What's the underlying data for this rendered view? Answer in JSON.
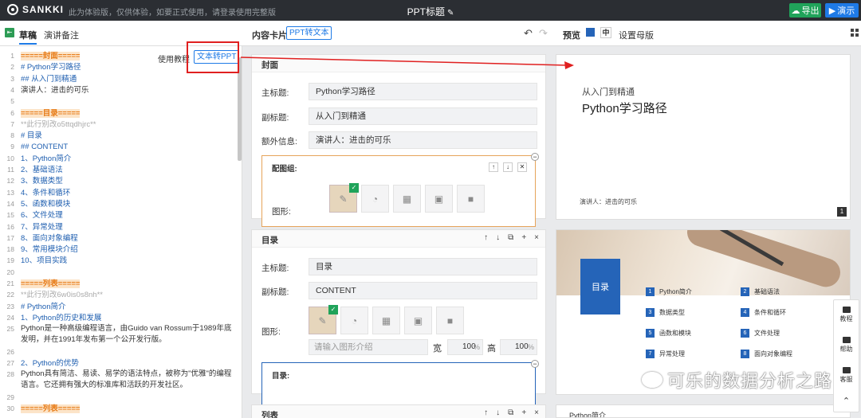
{
  "topbar": {
    "brand": "SANKKI",
    "trial_notice": "此为体验版，仅供体验，如要正式使用，请登录使用完整版",
    "doc_title": "PPT标题",
    "export_label": "导出",
    "present_label": "演示"
  },
  "toolbar": {
    "tab_draft": "草稿",
    "tab_notes": "演讲备注",
    "content_cards_title": "内容卡片",
    "ppt_to_text": "PPT转文本",
    "preview_label": "预览",
    "size_mid": "中",
    "set_master": "设置母版"
  },
  "editor": {
    "usage_link": "使用教程",
    "text_to_ppt": "文本转PPT",
    "lines": [
      {
        "n": "1",
        "text": "=====封面=====",
        "kind": "hl"
      },
      {
        "n": "2",
        "text": "# Python学习路径",
        "kind": "hd"
      },
      {
        "n": "3",
        "text": "## 从入门到精通",
        "kind": "hd"
      },
      {
        "n": "4",
        "text": "演讲人：进击的可乐",
        "kind": "plain"
      },
      {
        "n": "5",
        "text": "",
        "kind": "plain"
      },
      {
        "n": "6",
        "text": "=====目录=====",
        "kind": "hl"
      },
      {
        "n": "7",
        "text": "**此行别改o5ttqdhjrc**",
        "kind": "cm"
      },
      {
        "n": "8",
        "text": "# 目录",
        "kind": "hd"
      },
      {
        "n": "9",
        "text": "## CONTENT",
        "kind": "hd"
      },
      {
        "n": "10",
        "text": "1、Python简介",
        "kind": "ol"
      },
      {
        "n": "11",
        "text": "2、基础语法",
        "kind": "ol"
      },
      {
        "n": "12",
        "text": "3、数据类型",
        "kind": "ol"
      },
      {
        "n": "13",
        "text": "4、条件和循环",
        "kind": "ol"
      },
      {
        "n": "14",
        "text": "5、函数和模块",
        "kind": "ol"
      },
      {
        "n": "15",
        "text": "6、文件处理",
        "kind": "ol"
      },
      {
        "n": "16",
        "text": "7、异常处理",
        "kind": "ol"
      },
      {
        "n": "17",
        "text": "8、面向对象编程",
        "kind": "ol"
      },
      {
        "n": "18",
        "text": "9、常用模块介绍",
        "kind": "ol"
      },
      {
        "n": "19",
        "text": "10、项目实践",
        "kind": "ol"
      },
      {
        "n": "20",
        "text": "",
        "kind": "plain"
      },
      {
        "n": "21",
        "text": "=====列表=====",
        "kind": "hl"
      },
      {
        "n": "22",
        "text": "**此行别改6w0is0s8nh**",
        "kind": "cm"
      },
      {
        "n": "23",
        "text": "# Python简介",
        "kind": "hd"
      },
      {
        "n": "24",
        "text": "1、Python的历史和发展",
        "kind": "ol"
      },
      {
        "n": "25",
        "text": "Python是一种高级编程语言，由Guido van Rossum于1989年底发明，并在1991年发布第一个公开发行版。",
        "kind": "wrap"
      },
      {
        "n": "26",
        "text": "",
        "kind": "plain"
      },
      {
        "n": "27",
        "text": "2、Python的优势",
        "kind": "ol"
      },
      {
        "n": "28",
        "text": "Python具有简洁、易读、易学的语法特点，被称为\"优雅\"的编程语言。它还拥有强大的标准库和活跃的开发社区。",
        "kind": "wrap"
      },
      {
        "n": "29",
        "text": "",
        "kind": "plain"
      },
      {
        "n": "30",
        "text": "=====列表=====",
        "kind": "hl"
      }
    ]
  },
  "cards": {
    "cover": {
      "title": "封面",
      "main_title_label": "主标题:",
      "main_title_value": "Python学习路径",
      "subtitle_label": "副标题:",
      "subtitle_value": "从入门到精通",
      "extra_label": "额外信息:",
      "extra_value": "演讲人：进击的可乐",
      "group_label": "配图组:",
      "shape_label": "图形:"
    },
    "toc": {
      "title": "目录",
      "main_title_label": "主标题:",
      "main_title_value": "目录",
      "subtitle_label": "副标题:",
      "subtitle_value": "CONTENT",
      "shape_label": "图形:",
      "shape_placeholder": "请输入图形介绍",
      "width_label": "宽",
      "width_value": "100",
      "height_label": "高",
      "height_value": "100",
      "percent": "%",
      "sub_label": "目录:"
    },
    "list": {
      "title": "列表"
    }
  },
  "preview": {
    "slide1": {
      "subtitle": "从入门到精通",
      "title": "Python学习路径",
      "speaker": "演讲人：进击的可乐",
      "page": "1"
    },
    "slide2": {
      "box_title": "目录",
      "items": [
        {
          "n": "1",
          "text": "Python简介"
        },
        {
          "n": "2",
          "text": "基础语法"
        },
        {
          "n": "3",
          "text": "数据类型"
        },
        {
          "n": "4",
          "text": "条件和循环"
        },
        {
          "n": "5",
          "text": "函数和模块"
        },
        {
          "n": "6",
          "text": "文件处理"
        },
        {
          "n": "7",
          "text": "异常处理"
        },
        {
          "n": "8",
          "text": "面向对象编程"
        }
      ]
    },
    "slide3_peek": "Python简介"
  },
  "sidebar": {
    "tutorial": "教程",
    "help": "帮助",
    "service": "客服"
  },
  "watermark": "可乐的数据分析之路",
  "colors": {
    "accent_blue": "#1e7ae6",
    "export_green": "#20a35a",
    "heading_orange": "#e77b17",
    "highlight_red": "#e02020"
  }
}
